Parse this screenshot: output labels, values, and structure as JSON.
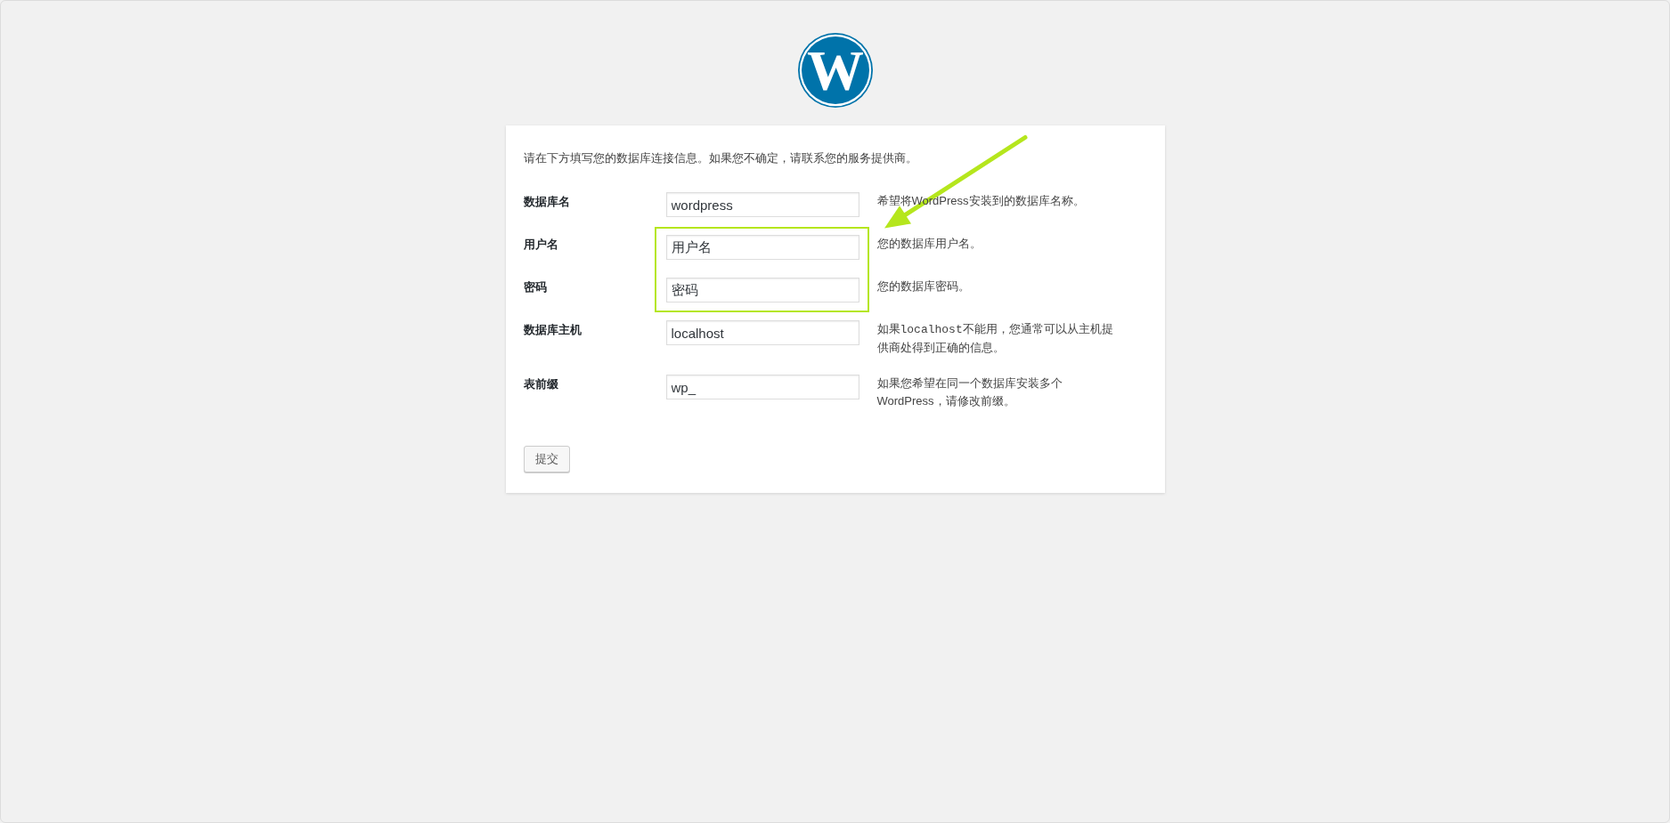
{
  "logo": {
    "letter": "W"
  },
  "intro": "请在下方填写您的数据库连接信息。如果您不确定，请联系您的服务提供商。",
  "fields": [
    {
      "label": "数据库名",
      "value": "wordpress",
      "highlighted": false,
      "description": [
        {
          "kind": "text",
          "text": "希望将WordPress安装到的数据库名称。"
        }
      ]
    },
    {
      "label": "用户名",
      "value": "用户名",
      "highlighted": true,
      "description": [
        {
          "kind": "text",
          "text": "您的数据库用户名。"
        }
      ]
    },
    {
      "label": "密码",
      "value": "密码",
      "highlighted": true,
      "description": [
        {
          "kind": "text",
          "text": "您的数据库密码。"
        }
      ]
    },
    {
      "label": "数据库主机",
      "value": "localhost",
      "highlighted": false,
      "description": [
        {
          "kind": "text",
          "text": "如果"
        },
        {
          "kind": "code",
          "text": "localhost"
        },
        {
          "kind": "text",
          "text": "不能用，您通常可以从主机提供商处得到正确的信息。"
        }
      ]
    },
    {
      "label": "表前缀",
      "value": "wp_",
      "highlighted": false,
      "description": [
        {
          "kind": "text",
          "text": "如果您希望在同一个数据库安装多个WordPress，请修改前缀。"
        }
      ]
    }
  ],
  "submit": {
    "label": "提交"
  }
}
